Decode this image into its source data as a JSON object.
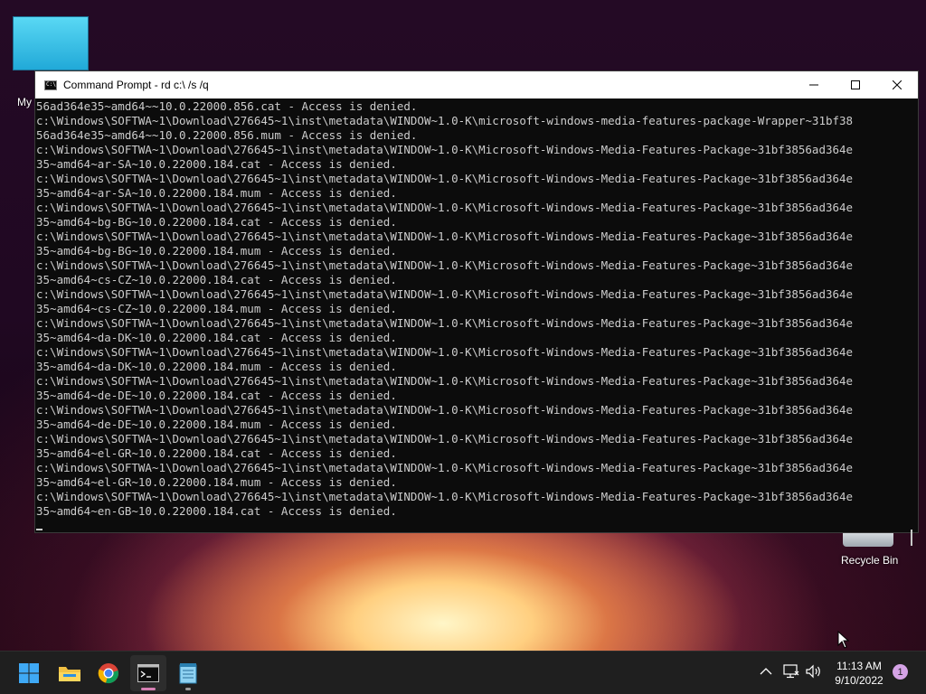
{
  "desktop": {
    "my_pc_label": "My",
    "recycle_bin_label": "Recycle Bin"
  },
  "window": {
    "title": "Command Prompt - rd  c:\\ /s /q",
    "lines": [
      "56ad364e35~amd64~~10.0.22000.856.cat - Access is denied.",
      "c:\\Windows\\SOFTWA~1\\Download\\276645~1\\inst\\metadata\\WINDOW~1.0-K\\microsoft-windows-media-features-package-Wrapper~31bf38",
      "56ad364e35~amd64~~10.0.22000.856.mum - Access is denied.",
      "c:\\Windows\\SOFTWA~1\\Download\\276645~1\\inst\\metadata\\WINDOW~1.0-K\\Microsoft-Windows-Media-Features-Package~31bf3856ad364e",
      "35~amd64~ar-SA~10.0.22000.184.cat - Access is denied.",
      "c:\\Windows\\SOFTWA~1\\Download\\276645~1\\inst\\metadata\\WINDOW~1.0-K\\Microsoft-Windows-Media-Features-Package~31bf3856ad364e",
      "35~amd64~ar-SA~10.0.22000.184.mum - Access is denied.",
      "c:\\Windows\\SOFTWA~1\\Download\\276645~1\\inst\\metadata\\WINDOW~1.0-K\\Microsoft-Windows-Media-Features-Package~31bf3856ad364e",
      "35~amd64~bg-BG~10.0.22000.184.cat - Access is denied.",
      "c:\\Windows\\SOFTWA~1\\Download\\276645~1\\inst\\metadata\\WINDOW~1.0-K\\Microsoft-Windows-Media-Features-Package~31bf3856ad364e",
      "35~amd64~bg-BG~10.0.22000.184.mum - Access is denied.",
      "c:\\Windows\\SOFTWA~1\\Download\\276645~1\\inst\\metadata\\WINDOW~1.0-K\\Microsoft-Windows-Media-Features-Package~31bf3856ad364e",
      "35~amd64~cs-CZ~10.0.22000.184.cat - Access is denied.",
      "c:\\Windows\\SOFTWA~1\\Download\\276645~1\\inst\\metadata\\WINDOW~1.0-K\\Microsoft-Windows-Media-Features-Package~31bf3856ad364e",
      "35~amd64~cs-CZ~10.0.22000.184.mum - Access is denied.",
      "c:\\Windows\\SOFTWA~1\\Download\\276645~1\\inst\\metadata\\WINDOW~1.0-K\\Microsoft-Windows-Media-Features-Package~31bf3856ad364e",
      "35~amd64~da-DK~10.0.22000.184.cat - Access is denied.",
      "c:\\Windows\\SOFTWA~1\\Download\\276645~1\\inst\\metadata\\WINDOW~1.0-K\\Microsoft-Windows-Media-Features-Package~31bf3856ad364e",
      "35~amd64~da-DK~10.0.22000.184.mum - Access is denied.",
      "c:\\Windows\\SOFTWA~1\\Download\\276645~1\\inst\\metadata\\WINDOW~1.0-K\\Microsoft-Windows-Media-Features-Package~31bf3856ad364e",
      "35~amd64~de-DE~10.0.22000.184.cat - Access is denied.",
      "c:\\Windows\\SOFTWA~1\\Download\\276645~1\\inst\\metadata\\WINDOW~1.0-K\\Microsoft-Windows-Media-Features-Package~31bf3856ad364e",
      "35~amd64~de-DE~10.0.22000.184.mum - Access is denied.",
      "c:\\Windows\\SOFTWA~1\\Download\\276645~1\\inst\\metadata\\WINDOW~1.0-K\\Microsoft-Windows-Media-Features-Package~31bf3856ad364e",
      "35~amd64~el-GR~10.0.22000.184.cat - Access is denied.",
      "c:\\Windows\\SOFTWA~1\\Download\\276645~1\\inst\\metadata\\WINDOW~1.0-K\\Microsoft-Windows-Media-Features-Package~31bf3856ad364e",
      "35~amd64~el-GR~10.0.22000.184.mum - Access is denied.",
      "c:\\Windows\\SOFTWA~1\\Download\\276645~1\\inst\\metadata\\WINDOW~1.0-K\\Microsoft-Windows-Media-Features-Package~31bf3856ad364e",
      "35~amd64~en-GB~10.0.22000.184.cat - Access is denied."
    ]
  },
  "taskbar": {
    "apps": [
      {
        "name": "start-button",
        "icon": "windows-logo-icon",
        "active": false
      },
      {
        "name": "file-explorer-button",
        "icon": "folder-icon",
        "active": false
      },
      {
        "name": "chrome-button",
        "icon": "chrome-icon",
        "active": false
      },
      {
        "name": "command-prompt-button",
        "icon": "terminal-icon",
        "active": true
      },
      {
        "name": "notepad-button",
        "icon": "notepad-icon",
        "active": false
      }
    ],
    "time": "11:13 AM",
    "date": "9/10/2022",
    "notification_count": "1"
  },
  "colors": {
    "console_bg": "#0c0c0c",
    "console_text": "#cccccc",
    "taskbar_bg": "#1f1f1f",
    "active_indicator": "#d47fb2",
    "badge": "#d5a3e6"
  }
}
